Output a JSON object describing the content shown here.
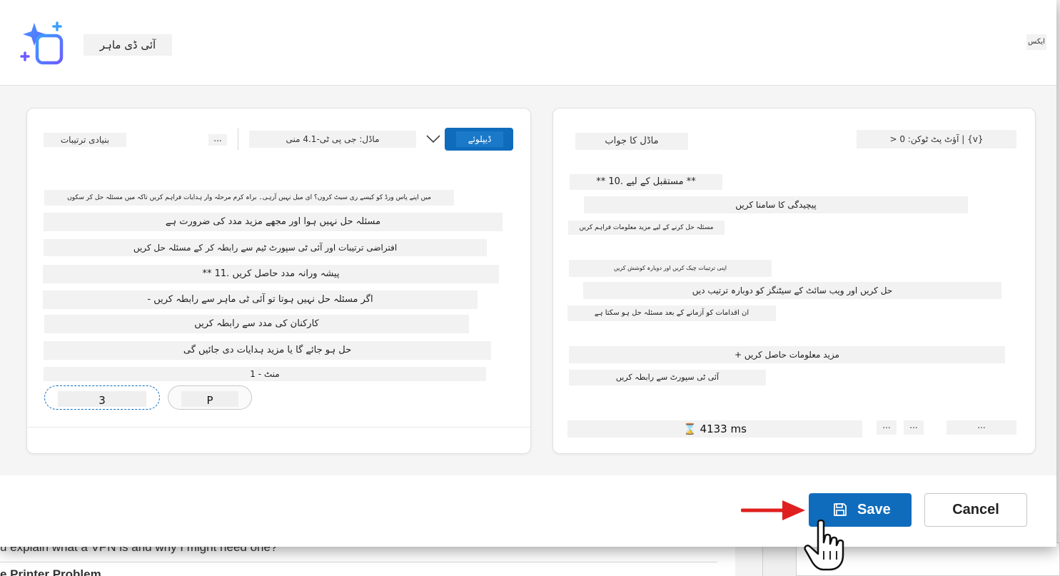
{
  "background": {
    "chat_line": "u explain what a VPN is and why I might need one?",
    "chat_heading": "e Printer Problem"
  },
  "header": {
    "title": "آئی ڈی ماہر",
    "right_text": "ایکس"
  },
  "left_panel": {
    "tab_label": "بنیادی ترتیبات",
    "dots": "...",
    "model_select": "ماڈل: جی پی ٹی-4.1 منی",
    "deploy_label": "ڈیپلوئے",
    "lines": [
      "میں اپنے پاس ورڈ کو کیسے ری سیٹ کروں؟ ای میل نہیں آرہی۔ براہ کرم مرحلہ وار ہدایات فراہم کریں تاکہ میں مسئلہ حل کر سکوں",
      "مسئلہ حل نہیں ہوا اور مجھے مزید مدد کی ضرورت ہے",
      "افتراضی ترتیبات اور آئی ٹی سپورٹ ٹیم سے رابطہ کر کے مسئلہ حل کریں",
      "** 11. پیشہ ورانہ مدد حاصل کریں",
      "- اگر مسئلہ حل نہیں ہوتا تو آئی ٹی ماہر سے رابطہ کریں",
      "کارکنان کی مدد سے رابطہ کریں",
      "حل ہو جائے گا یا مزید ہدایات دی جائیں گی",
      "1 - منٹ"
    ],
    "pill_a": "3",
    "pill_b": "P"
  },
  "right_panel": {
    "header_label": "ماڈل کا جواب",
    "tokens": "> آؤٹ پٹ ٹوکن: 0 | {v}",
    "lines": [
      "** 10. مستقبل کے لیے **",
      "پیچیدگی کا سامنا کریں",
      "مسئلہ حل کرنے کے لیے مزید معلومات فراہم کریں",
      "اپنی ترتیبات چیک کریں اور دوبارہ کوشش کریں",
      "حل کریں اور ویب سائٹ کے سیٹنگز کو دوبارہ ترتیب دیں",
      "ان اقدامات کو آزمانے کے بعد مسئلہ حل ہو سکتا ہے",
      "+ مزید معلومات حاصل کریں",
      "آئی ٹی سپورٹ سے رابطہ کریں"
    ],
    "latency": "⌛ 4133 ms",
    "mini_a": "...",
    "mini_b": "...",
    "mini_c": "..."
  },
  "footer": {
    "save_label": "Save",
    "cancel_label": "Cancel"
  },
  "colors": {
    "primary": "#0f6cbd",
    "arrow": "#e02020"
  }
}
